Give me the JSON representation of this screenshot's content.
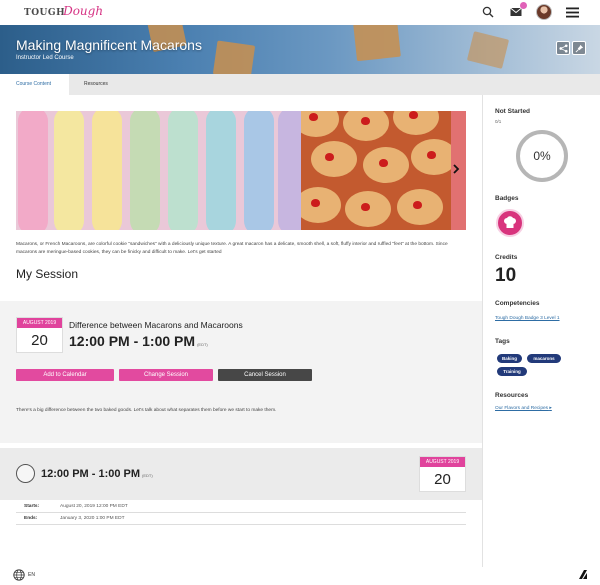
{
  "brand": {
    "logo_tough": "TOUGH",
    "logo_dough": "Dough"
  },
  "header": {
    "icons": [
      "search-icon",
      "mail-icon",
      "avatar",
      "menu-icon"
    ]
  },
  "course": {
    "title": "Making Magnificent Macarons",
    "subtitle": "Instructor Led Course"
  },
  "tabs": [
    {
      "label": "Course Content",
      "active": true
    },
    {
      "label": "Resources",
      "active": false
    }
  ],
  "description": "Macarons, or French Macaroons, are colorful cookie \"sandwiches\" with a  deliciously unique texture. A great macaron has a delicate, smooth shell,  a soft, fluffy interior and ruffled \"feet\" at the bottom. Since macarons are meringue-based cookies, they can be finicky and difficult to make. Let's get started",
  "my_session_heading": "My Session",
  "session": {
    "month": "AUGUST 2019",
    "day": "20",
    "title": "Difference between Macarons and Macaroons",
    "time": "12:00 PM - 1:00 PM",
    "tz": "(EDT)",
    "buttons": {
      "add_calendar": "Add to Calendar",
      "change": "Change Session",
      "cancel": "Cancel Session"
    },
    "note": "There's a big difference between the two baked goods. Let's talk about what separates them before we start to make them."
  },
  "alt_session": {
    "time": "12:00 PM - 1:00 PM",
    "tz": "(EDT)",
    "month": "AUGUST 2019",
    "day": "20",
    "starts_label": "Starts:",
    "starts_value": "August 20, 2019 12:00 PM EDT",
    "ends_label": "Ends:",
    "ends_value": "January 3, 2020 1:00 PM EDT"
  },
  "sidebar": {
    "status_heading": "Not Started",
    "status_count": "0/1",
    "progress_label": "0%",
    "progress": 0,
    "badges_heading": "Badges",
    "credits_heading": "Credits",
    "credits_value": "10",
    "competencies_heading": "Competencies",
    "competency_link": "Tough Dough Badge 3 Level 1",
    "tags_heading": "Tags",
    "tags": [
      "Baking",
      "macarons",
      "Training"
    ],
    "resources_heading": "Resources",
    "resource_link": "Our Flavors and Recipes"
  },
  "footer": {
    "language": "EN"
  },
  "colors": {
    "accent_pink": "#e24a9f",
    "tag_navy": "#223a7a",
    "link_blue": "#2e6da4"
  }
}
